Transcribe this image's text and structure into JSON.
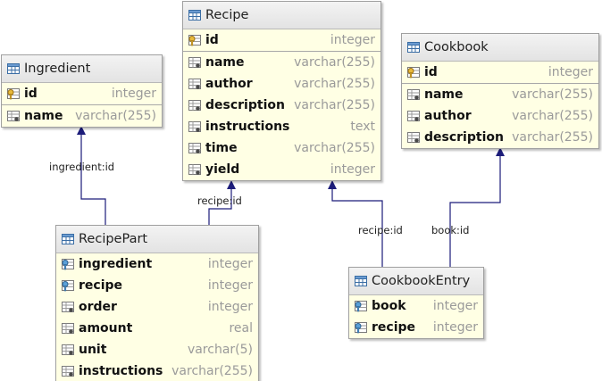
{
  "colors": {
    "relationship_line": "#1c1c7a",
    "table_body": "#ffffe4",
    "type_text": "#9a9a9a"
  },
  "tables": {
    "ingredient": {
      "name": "Ingredient",
      "icon": "table-icon",
      "pk": [
        {
          "name": "id",
          "type": "integer",
          "icon": "primary-key-icon"
        }
      ],
      "columns": [
        {
          "name": "name",
          "type": "varchar(255)",
          "icon": "column-icon"
        }
      ]
    },
    "recipe": {
      "name": "Recipe",
      "icon": "table-icon",
      "pk": [
        {
          "name": "id",
          "type": "integer",
          "icon": "primary-key-icon"
        }
      ],
      "columns": [
        {
          "name": "name",
          "type": "varchar(255)",
          "icon": "column-icon"
        },
        {
          "name": "author",
          "type": "varchar(255)",
          "icon": "column-icon"
        },
        {
          "name": "description",
          "type": "varchar(255)",
          "icon": "column-icon"
        },
        {
          "name": "instructions",
          "type": "text",
          "icon": "column-icon"
        },
        {
          "name": "time",
          "type": "varchar(255)",
          "icon": "column-icon"
        },
        {
          "name": "yield",
          "type": "integer",
          "icon": "column-icon"
        }
      ]
    },
    "cookbook": {
      "name": "Cookbook",
      "icon": "table-icon",
      "pk": [
        {
          "name": "id",
          "type": "integer",
          "icon": "primary-key-icon"
        }
      ],
      "columns": [
        {
          "name": "name",
          "type": "varchar(255)",
          "icon": "column-icon"
        },
        {
          "name": "author",
          "type": "varchar(255)",
          "icon": "column-icon"
        },
        {
          "name": "description",
          "type": "varchar(255)",
          "icon": "column-icon"
        }
      ]
    },
    "recipepart": {
      "name": "RecipePart",
      "icon": "table-icon",
      "pk": [],
      "columns": [
        {
          "name": "ingredient",
          "type": "integer",
          "icon": "foreign-key-icon"
        },
        {
          "name": "recipe",
          "type": "integer",
          "icon": "foreign-key-icon"
        },
        {
          "name": "order",
          "type": "integer",
          "icon": "column-icon"
        },
        {
          "name": "amount",
          "type": "real",
          "icon": "column-icon"
        },
        {
          "name": "unit",
          "type": "varchar(5)",
          "icon": "column-icon"
        },
        {
          "name": "instructions",
          "type": "varchar(255)",
          "icon": "column-icon"
        }
      ]
    },
    "cookbookentry": {
      "name": "CookbookEntry",
      "icon": "table-icon",
      "pk": [],
      "columns": [
        {
          "name": "book",
          "type": "integer",
          "icon": "foreign-key-icon"
        },
        {
          "name": "recipe",
          "type": "integer",
          "icon": "foreign-key-icon"
        }
      ]
    }
  },
  "relationships": {
    "ingredient_id": "ingredient:id",
    "recipe_id_part": "recipe:id",
    "recipe_id_entry": "recipe:id",
    "book_id": "book:id"
  }
}
